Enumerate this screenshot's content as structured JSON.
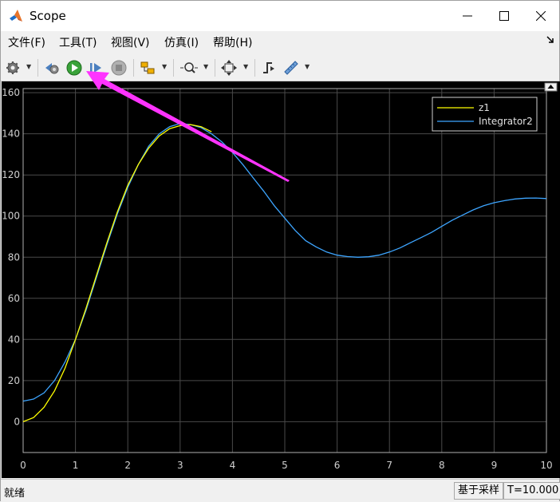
{
  "window": {
    "title": "Scope",
    "controls": [
      "minimize",
      "maximize",
      "close"
    ]
  },
  "menu": [
    {
      "label": "文件(F)"
    },
    {
      "label": "工具(T)"
    },
    {
      "label": "视图(V)"
    },
    {
      "label": "仿真(I)"
    },
    {
      "label": "帮助(H)"
    }
  ],
  "toolbar": [
    {
      "name": "configuration-properties",
      "icon": "gear-icon",
      "has_dropdown": true
    },
    {
      "name": "step-back",
      "icon": "step-back-icon"
    },
    {
      "name": "run",
      "icon": "run-icon"
    },
    {
      "name": "step-forward",
      "icon": "step-forward-icon"
    },
    {
      "name": "stop",
      "icon": "stop-icon"
    },
    {
      "name": "highlight-block",
      "icon": "highlight-icon",
      "has_dropdown": true
    },
    {
      "name": "zoom",
      "icon": "zoom-icon",
      "has_dropdown": true
    },
    {
      "name": "autoscale",
      "icon": "autoscale-icon",
      "has_dropdown": true
    },
    {
      "name": "triggers",
      "icon": "trigger-icon"
    },
    {
      "name": "cursor-measurements",
      "icon": "ruler-icon",
      "has_dropdown": true
    }
  ],
  "chart_data": {
    "type": "line",
    "title": "",
    "xlabel": "",
    "ylabel": "",
    "xlim": [
      0,
      10
    ],
    "ylim": [
      -15,
      162
    ],
    "xticks": [
      0,
      1,
      2,
      3,
      4,
      5,
      6,
      7,
      8,
      9,
      10
    ],
    "yticks": [
      0,
      20,
      40,
      60,
      80,
      100,
      120,
      140,
      160
    ],
    "grid": true,
    "background": "#000000",
    "legend": {
      "placement": "top-right"
    },
    "series": [
      {
        "name": "z1",
        "color": "#ffff00",
        "x": [
          0,
          0.2,
          0.4,
          0.6,
          0.8,
          1.0,
          1.2,
          1.4,
          1.6,
          1.8,
          2.0,
          2.2,
          2.4,
          2.6,
          2.8,
          3.0,
          3.2,
          3.4,
          3.6
        ],
        "y": [
          0,
          2,
          7,
          15,
          26,
          40,
          55,
          71,
          87,
          102,
          115,
          125,
          133,
          139,
          142.5,
          144,
          144.5,
          143.5,
          141
        ]
      },
      {
        "name": "Integrator2",
        "color": "#3da5ff",
        "x": [
          0,
          0.2,
          0.4,
          0.6,
          0.8,
          1.0,
          1.2,
          1.4,
          1.6,
          1.8,
          2.0,
          2.2,
          2.4,
          2.6,
          2.8,
          3.0,
          3.2,
          3.4,
          3.6,
          3.8,
          4.0,
          4.2,
          4.4,
          4.6,
          4.8,
          5.0,
          5.2,
          5.4,
          5.6,
          5.8,
          6.0,
          6.2,
          6.4,
          6.6,
          6.8,
          7.0,
          7.2,
          7.4,
          7.6,
          7.8,
          8.0,
          8.2,
          8.4,
          8.6,
          8.8,
          9.0,
          9.2,
          9.4,
          9.6,
          9.8,
          10.0
        ],
        "y": [
          10,
          11,
          14,
          20,
          29,
          40,
          54,
          70,
          86,
          101,
          114,
          125,
          134,
          140,
          143.5,
          145,
          144.5,
          143,
          140,
          136,
          131,
          125,
          118.5,
          112,
          105,
          99,
          93,
          88,
          85,
          82.5,
          81,
          80.3,
          80,
          80.2,
          81,
          82.5,
          84.5,
          87,
          89.5,
          92,
          95,
          98,
          100.5,
          103,
          105,
          106.5,
          107.5,
          108.3,
          108.7,
          108.8,
          108.5
        ]
      }
    ]
  },
  "status": {
    "left_text": "就绪",
    "sample_mode": "基于采样",
    "time": "T=10.000"
  },
  "annotation": {
    "arrow_color": "#ff33ff"
  }
}
